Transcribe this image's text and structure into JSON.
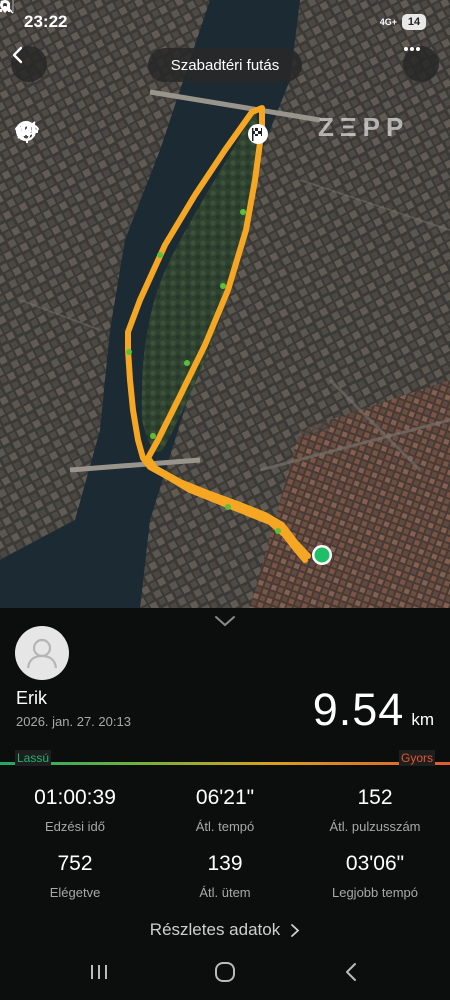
{
  "status_bar": {
    "time": "23:22",
    "network_label": "4G+",
    "battery": "14",
    "icons": [
      "mute-icon",
      "location-icon",
      "signal-icon",
      "signal-icon",
      "battery-icon"
    ]
  },
  "header": {
    "title": "Szabadtéri futás",
    "back_icon": "chevron-left-icon",
    "more_icon": "more-dots-icon"
  },
  "map": {
    "brand": "ZΞPP",
    "tools": [
      "hide-route-icon",
      "globe-icon",
      "eye-icon",
      "locate-icon"
    ],
    "route_color": "#f5a623",
    "start_color": "#1fbf6a",
    "finish_icon": "checkered-flag-icon"
  },
  "workout": {
    "user_name": "Erik",
    "date": "2026. jan. 27. 20:13",
    "distance_value": "9.54",
    "distance_unit": "km"
  },
  "pace_scale": {
    "slow_label": "Lassú",
    "fast_label": "Gyors",
    "slow_color": "#1fa86b",
    "fast_color": "#e05a2e"
  },
  "stats": [
    {
      "value": "01:00:39",
      "label": "Edzési idő"
    },
    {
      "value": "06'21\"",
      "label": "Átl. tempó"
    },
    {
      "value": "152",
      "label": "Átl. pulzusszám"
    },
    {
      "value": "752",
      "label": "Elégetve"
    },
    {
      "value": "139",
      "label": "Átl. ütem"
    },
    {
      "value": "03'06\"",
      "label": "Legjobb tempó"
    }
  ],
  "details": {
    "label": "Részletes adatok"
  },
  "nav": {
    "items": [
      "recent-apps-icon",
      "home-icon",
      "back-icon"
    ]
  }
}
